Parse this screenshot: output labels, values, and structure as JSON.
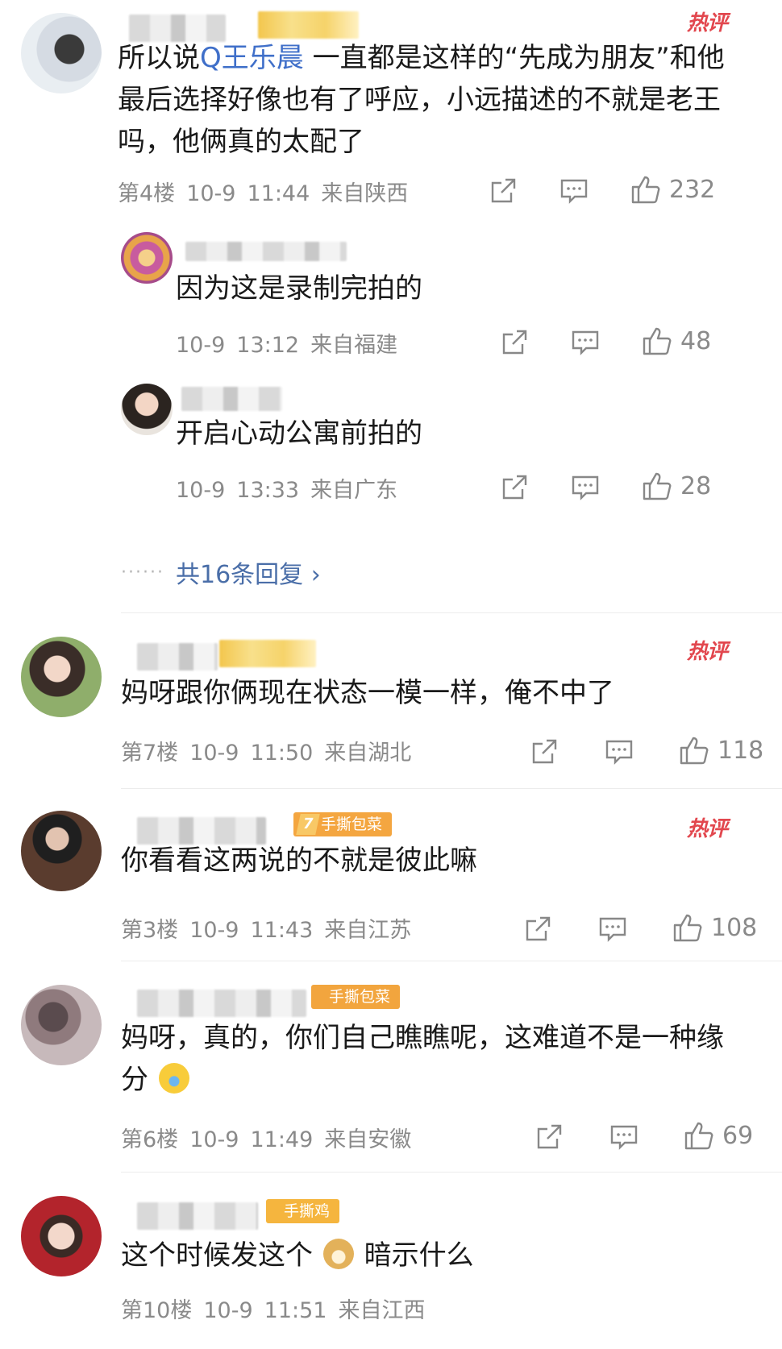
{
  "comments": [
    {
      "floor": "第4楼",
      "date": "10-9",
      "time": "11:44",
      "region": "来自陕西",
      "likes": "232",
      "hot": "热评",
      "text_pre": "所以说",
      "mention": "Q王乐晨",
      "text_post": " 一直都是这样的“先成为朋友”和他最后选择好像也有了呼应，小远描述的不就是老王吗，他俩真的太配了"
    },
    {
      "date": "10-9",
      "time": "13:12",
      "region": "来自福建",
      "likes": "48",
      "text": "因为这是录制完拍的"
    },
    {
      "date": "10-9",
      "time": "13:33",
      "region": "来自广东",
      "likes": "28",
      "text": "开启心动公寓前拍的"
    },
    {
      "floor": "第7楼",
      "date": "10-9",
      "time": "11:50",
      "region": "来自湖北",
      "likes": "118",
      "hot": "热评",
      "text": "妈呀跟你俩现在状态一模一样，俺不中了"
    },
    {
      "floor": "第3楼",
      "date": "10-9",
      "time": "11:43",
      "region": "来自江苏",
      "likes": "108",
      "hot": "热评",
      "medal_num": "7",
      "medal": "手撕包菜",
      "text": "你看看这两说的不就是彼此嘛"
    },
    {
      "floor": "第6楼",
      "date": "10-9",
      "time": "11:49",
      "region": "来自安徽",
      "likes": "69",
      "medal": "手撕包菜",
      "text": "妈呀，真的，你们自己瞧瞧呢，这难道不是一种缘分"
    },
    {
      "floor": "第10楼",
      "date": "10-9",
      "time": "11:51",
      "region": "来自江西",
      "medal": "手撕鸡",
      "text_pre": "这个时候发这个",
      "text_post": "暗示什么"
    }
  ],
  "replies_more": "共16条回复 ›",
  "colors": {
    "hot": "#e2474e",
    "mention": "#3f6fc9",
    "medal": "#f4a640",
    "meta": "#8a8a8a"
  },
  "icons": [
    "share-icon",
    "comment-icon",
    "like-icon",
    "emoji-crying-icon",
    "emoji-doge-icon"
  ]
}
